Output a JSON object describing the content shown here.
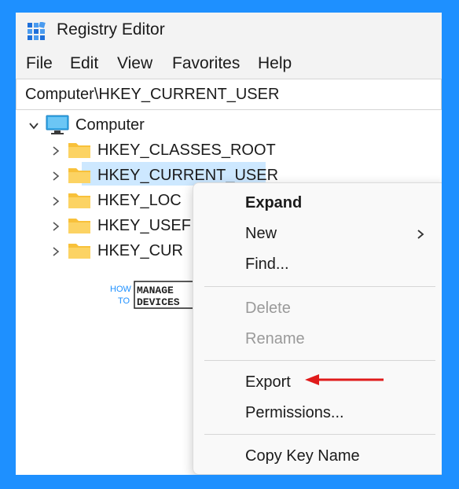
{
  "window": {
    "title": "Registry Editor"
  },
  "menubar": [
    "File",
    "Edit",
    "View",
    "Favorites",
    "Help"
  ],
  "address": {
    "value": "Computer\\HKEY_CURRENT_USER"
  },
  "tree": {
    "root": "Computer",
    "items": [
      {
        "label": "HKEY_CLASSES_ROOT",
        "selected": false
      },
      {
        "label": "HKEY_CURRENT_USER",
        "selected": true
      },
      {
        "label": "HKEY_LOC",
        "selected": false
      },
      {
        "label": "HKEY_USEF",
        "selected": false
      },
      {
        "label": "HKEY_CUR",
        "selected": false
      }
    ]
  },
  "watermark": {
    "line1": "HOW",
    "line2": "TO",
    "line3": "MANAGE",
    "line4": "DEVICES"
  },
  "context_menu": {
    "items": [
      {
        "label": "Expand",
        "bold": true,
        "disabled": false
      },
      {
        "label": "New",
        "bold": false,
        "disabled": false,
        "has_submenu": true
      },
      {
        "label": "Find...",
        "bold": false,
        "disabled": false
      },
      {
        "label": "Delete",
        "bold": false,
        "disabled": true
      },
      {
        "label": "Rename",
        "bold": false,
        "disabled": true
      },
      {
        "label": "Export",
        "bold": false,
        "disabled": false,
        "highlighted_by_arrow": true
      },
      {
        "label": "Permissions...",
        "bold": false,
        "disabled": false
      },
      {
        "label": "Copy Key Name",
        "bold": false,
        "disabled": false
      }
    ]
  },
  "colors": {
    "background": "#1e90ff",
    "selection": "#cde8ff",
    "folder": "#f8c13a",
    "arrow": "#e01b1b",
    "disabled_text": "#9a9a9a"
  }
}
